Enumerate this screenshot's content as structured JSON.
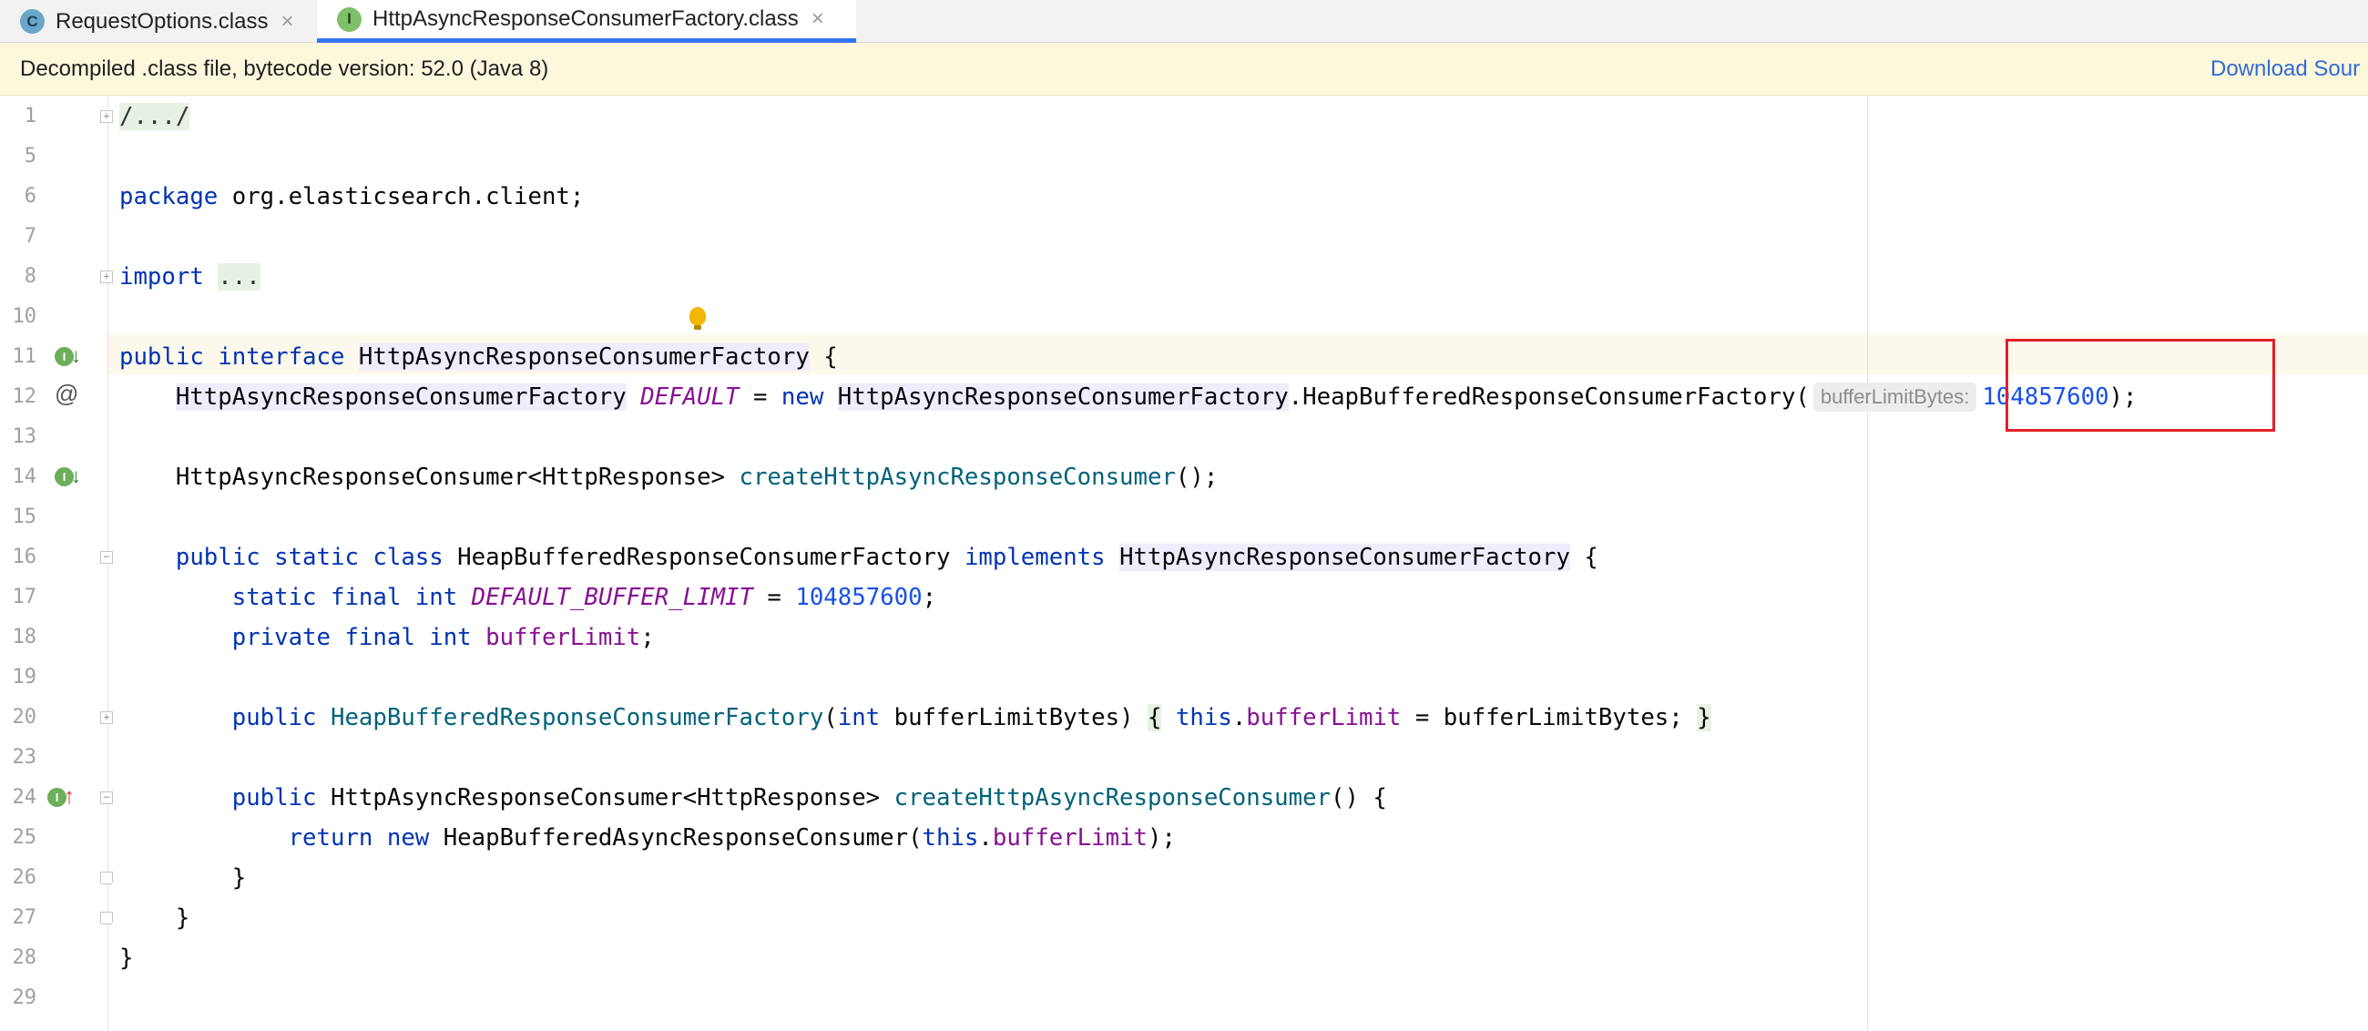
{
  "tabs": [
    {
      "label": "RequestOptions.class",
      "icon": "class-icon",
      "icon_letter": "C",
      "active": false
    },
    {
      "label": "HttpAsyncResponseConsumerFactory.class",
      "icon": "interface-icon",
      "icon_letter": "I",
      "active": true
    }
  ],
  "close_glyph": "×",
  "banner": {
    "text": "Decompiled .class file, bytecode version: 52.0 (Java 8)",
    "link": "Download Sour"
  },
  "colors": {
    "keyword": "#0033b3",
    "number": "#1750eb",
    "field": "#871094",
    "method": "#00627a",
    "highlight_box": "#e3202a",
    "tab_accent": "#3574f0"
  },
  "editor": {
    "line_numbers": [
      "1",
      "5",
      "6",
      "7",
      "8",
      "10",
      "11",
      "12",
      "13",
      "14",
      "15",
      "16",
      "17",
      "18",
      "19",
      "20",
      "23",
      "24",
      "25",
      "26",
      "27",
      "28",
      "29"
    ],
    "code": {
      "l1": "/.../",
      "l6_kw": "package",
      "l6_rest": " org.elasticsearch.client;",
      "l8_kw": "import",
      "l8_fold": "...",
      "l11_kw1": "public",
      "l11_kw2": "interface",
      "l11_name": "HttpAsyncResponseConsumerFactory",
      "l11_end": " {",
      "l12_type": "HttpAsyncResponseConsumerFactory",
      "l12_field": "DEFAULT",
      "l12_eq": " = ",
      "l12_new": "new",
      "l12_type2": "HttpAsyncResponseConsumerFactory",
      "l12_inner": ".HeapBufferedResponseConsumerFactory(",
      "l12_hint": "bufferLimitBytes:",
      "l12_num": "104857600",
      "l12_end": ");",
      "l14_type": "HttpAsyncResponseConsumer<HttpResponse> ",
      "l14_method": "createHttpAsyncResponseConsumer",
      "l14_end": "();",
      "l16_kw": "public static class",
      "l16_name": " HeapBufferedResponseConsumerFactory ",
      "l16_impl": "implements",
      "l16_iface": "HttpAsyncResponseConsumerFactory",
      "l16_end": " {",
      "l17_kw": "static final int",
      "l17_field": "DEFAULT_BUFFER_LIMIT",
      "l17_eq": " = ",
      "l17_num": "104857600",
      "l17_end": ";",
      "l18_kw": "private final int",
      "l18_field": "bufferLimit",
      "l18_end": ";",
      "l20_kw": "public",
      "l20_method": "HeapBufferedResponseConsumerFactory",
      "l20_paren": "(",
      "l20_int": "int",
      "l20_param": " bufferLimitBytes)",
      "l20_ob": "{",
      "l20_this": "this",
      "l20_dot": ".",
      "l20_field": "bufferLimit",
      "l20_assign": " = bufferLimitBytes;",
      "l20_cb": "}",
      "l24_kw": "public",
      "l24_type": " HttpAsyncResponseConsumer<HttpResponse> ",
      "l24_method": "createHttpAsyncResponseConsumer",
      "l24_end": "() {",
      "l25_kw": "return new",
      "l25_type": " HeapBufferedAsyncResponseConsumer(",
      "l25_this": "this",
      "l25_dot": ".",
      "l25_field": "bufferLimit",
      "l25_end": ");",
      "l26": "}",
      "l27": "}",
      "l28": "}"
    }
  }
}
